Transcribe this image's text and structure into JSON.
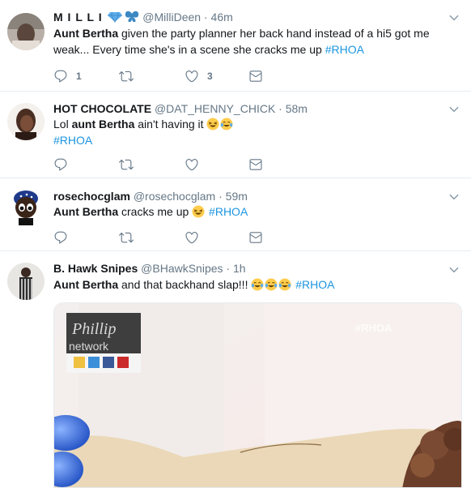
{
  "tweets": [
    {
      "name": "M I L L I",
      "handle": "@MilliDeen",
      "time": "46m",
      "bold": "Aunt Bertha",
      "text": " given the party planner her back hand  instead of a hi5 got me weak... Every time she's in a scene she cracks me up ",
      "hashtag": "#RHOA",
      "reply_count": "1",
      "like_count": "3"
    },
    {
      "name": "HOT CHOCOLATE",
      "handle": "@DAT_HENNY_CHICK",
      "time": "58m",
      "pre": "Lol ",
      "bold": "aunt Bertha",
      "text": " ain't having it ",
      "hashtag": "#RHOA"
    },
    {
      "name": "rosechocglam",
      "handle": "@rosechocglam",
      "time": "59m",
      "bold": "Aunt Bertha",
      "text": " cracks me up ",
      "hashtag": "#RHOA"
    },
    {
      "name": "B. Hawk Snipes",
      "handle": "@BHawkSnipes",
      "time": "1h",
      "bold": "Aunt Bertha",
      "text": " and that backhand slap!!! ",
      "hashtag": "#RHOA"
    }
  ],
  "media": {
    "watermark_top": "Phillip",
    "watermark_bottom": "network",
    "overlay_text": "#RHOA"
  },
  "icons": {
    "reply": "reply-icon",
    "retweet": "retweet-icon",
    "like": "heart-icon",
    "dm": "envelope-icon",
    "verified_gem": "diamond-emoji",
    "butterfly": "butterfly-emoji",
    "laugh": "laughing-emoji",
    "tears": "tears-of-joy-emoji",
    "caret": "chevron-down-icon"
  },
  "colors": {
    "link": "#1b95e0",
    "secondary": "#657786",
    "border": "#e6ecf0"
  }
}
